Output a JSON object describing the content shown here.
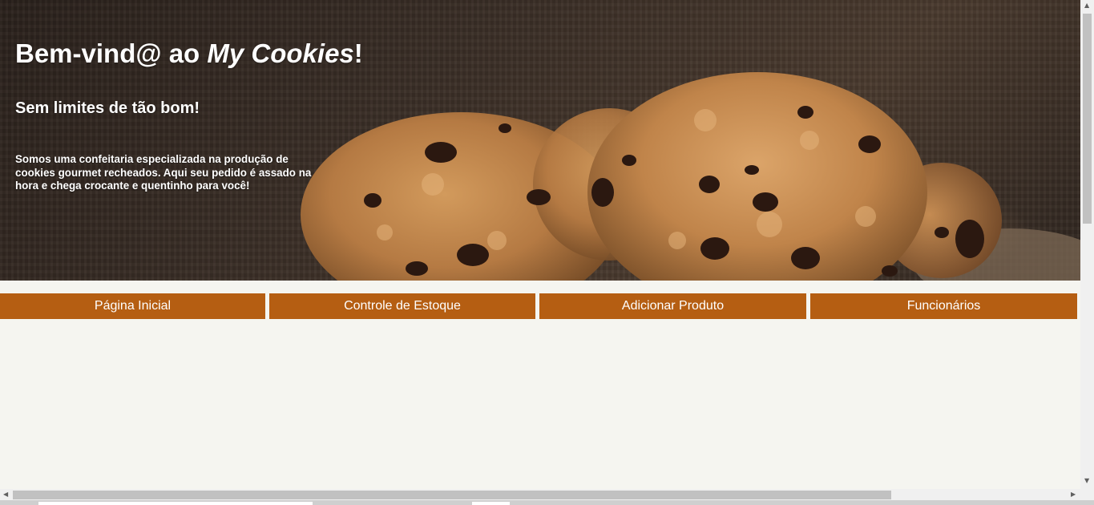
{
  "hero": {
    "title_prefix": "Bem-vind@ ao ",
    "title_brand": "My Cookies",
    "title_suffix": "!",
    "subtitle": "Sem limites de tão bom!",
    "description": "Somos uma confeitaria especializada na produção de cookies gourmet recheados. Aqui seu pedido é assado na hora e chega crocante e quentinho para você!",
    "image": "chocolate-chip-cookies-photo"
  },
  "nav": {
    "items": [
      {
        "label": "Página Inicial"
      },
      {
        "label": "Controle de Estoque"
      },
      {
        "label": "Adicionar Produto"
      },
      {
        "label": "Funcionários"
      }
    ]
  },
  "colors": {
    "nav_background": "#b55e12",
    "nav_text": "#ffffff",
    "page_background": "#f5f5f0",
    "hero_text": "#ffffff"
  },
  "scrollbars": {
    "vertical_up_icon": "arrow-up-icon",
    "vertical_down_icon": "arrow-down-icon",
    "horizontal_left_icon": "arrow-left-icon",
    "horizontal_right_icon": "arrow-right-icon"
  }
}
